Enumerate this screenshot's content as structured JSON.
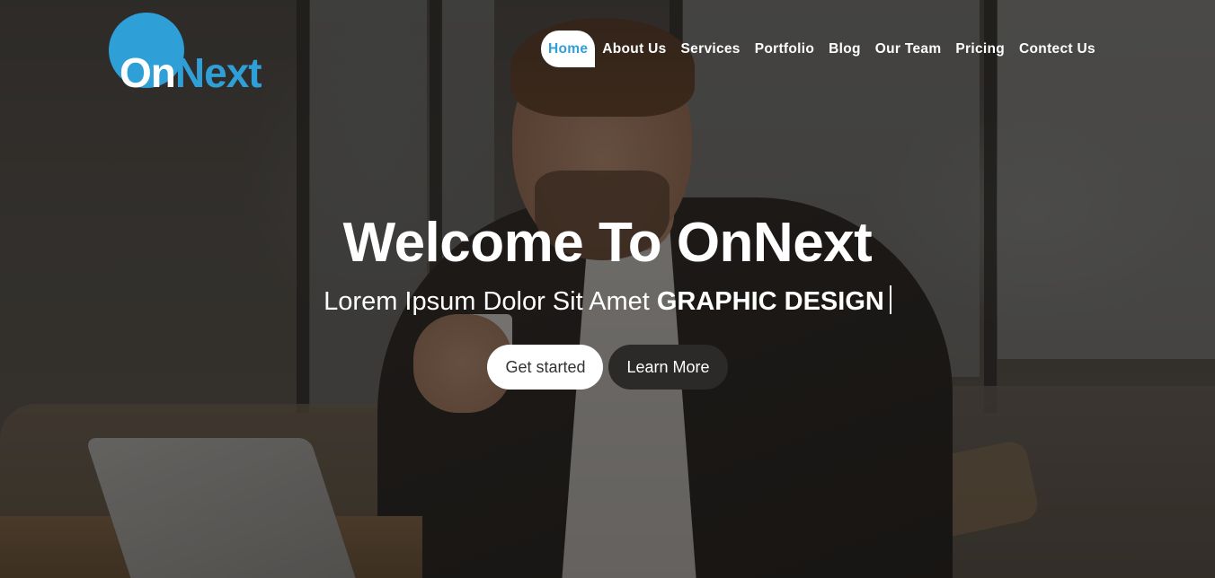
{
  "brand": {
    "logo_on": "On",
    "logo_next": "Next",
    "accent": "#2f9fd8"
  },
  "nav": {
    "items": [
      {
        "label": "Home",
        "active": true
      },
      {
        "label": "About Us"
      },
      {
        "label": "Services"
      },
      {
        "label": "Portfolio"
      },
      {
        "label": "Blog"
      },
      {
        "label": "Our Team"
      },
      {
        "label": "Pricing"
      },
      {
        "label": "Contect Us"
      }
    ]
  },
  "hero": {
    "title": "Welcome To OnNext",
    "subtitle": "Lorem Ipsum Dolor Sit Amet",
    "typed_text": "GRAPHIC DESIGN",
    "primary_button": "Get started",
    "secondary_button": "Learn More"
  }
}
